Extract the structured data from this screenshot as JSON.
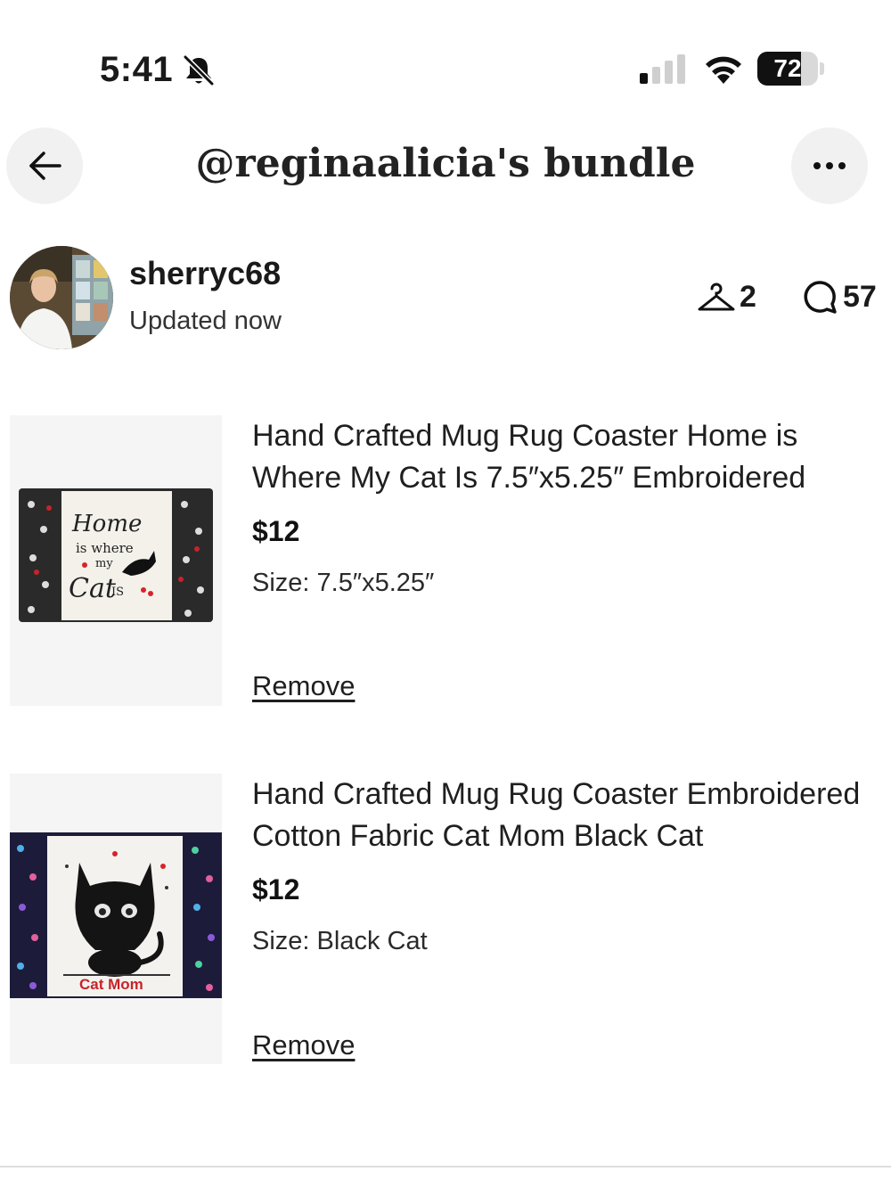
{
  "status_bar": {
    "time": "5:41",
    "battery_percent": "72",
    "battery_level": 0.72,
    "signal_bars_active": 1,
    "signal_bars_total": 4,
    "icons": [
      "bell-slash-icon",
      "signal-icon",
      "wifi-icon",
      "battery-icon"
    ]
  },
  "header": {
    "title": "@reginaalicia's bundle",
    "back_icon": "arrow-left-icon",
    "more_icon": "ellipsis-icon"
  },
  "owner": {
    "username": "sherryc68",
    "updated": "Updated now",
    "likes_icon": "hanger-icon",
    "likes_count": "2",
    "comments_icon": "comment-icon",
    "comments_count": "57"
  },
  "listings": [
    {
      "title": "Hand Crafted Mug Rug Coaster Home is Where My Cat Is 7.5″x5.25″ Embroidered",
      "price": "$12",
      "size": "Size: 7.5″x5.25″",
      "remove_label": "Remove",
      "image_text": [
        "Home",
        "is where",
        "my",
        "Cat",
        "IS"
      ]
    },
    {
      "title": "Hand Crafted Mug Rug Coaster Embroidered Cotton Fabric Cat Mom Black Cat",
      "price": "$12",
      "size": "Size: Black Cat",
      "remove_label": "Remove",
      "image_text": [
        "Cat Mom"
      ]
    }
  ],
  "colors": {
    "text": "#1a1a1a",
    "button_bg": "#f1f1f1",
    "heart_red": "#d8232a",
    "divider": "#dedede"
  }
}
